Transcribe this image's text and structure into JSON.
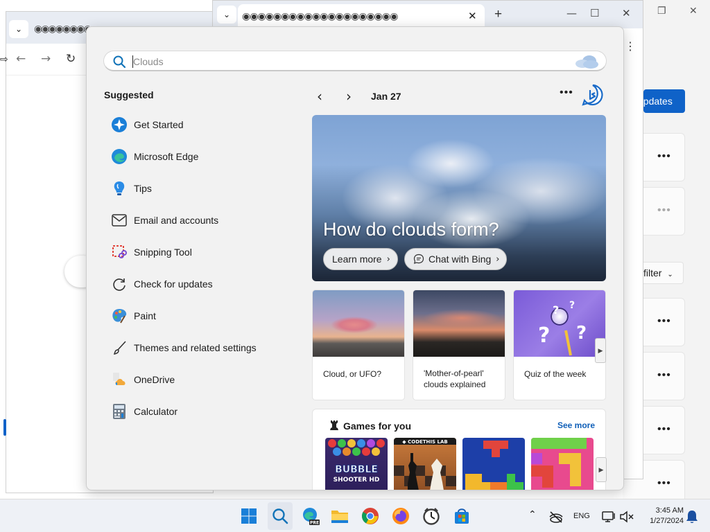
{
  "search": {
    "placeholder": "Clouds",
    "value": ""
  },
  "suggested": {
    "title": "Suggested",
    "items": [
      {
        "label": "Get Started",
        "icon": "get-started-icon"
      },
      {
        "label": "Microsoft Edge",
        "icon": "edge-icon"
      },
      {
        "label": "Tips",
        "icon": "tips-icon"
      },
      {
        "label": "Email and accounts",
        "icon": "mail-icon"
      },
      {
        "label": "Snipping Tool",
        "icon": "snipping-tool-icon"
      },
      {
        "label": "Check for updates",
        "icon": "refresh-icon"
      },
      {
        "label": "Paint",
        "icon": "paint-icon"
      },
      {
        "label": "Themes and related settings",
        "icon": "brush-icon"
      },
      {
        "label": "OneDrive",
        "icon": "onedrive-icon"
      },
      {
        "label": "Calculator",
        "icon": "calculator-icon"
      }
    ]
  },
  "highlights": {
    "date": "Jan 27",
    "hero": {
      "title": "How do clouds form?",
      "learn_more": "Learn more",
      "chat_bing": "Chat with Bing"
    },
    "cards": [
      {
        "caption": "Cloud, or UFO?"
      },
      {
        "caption": "'Mother-of-pearl' clouds explained"
      },
      {
        "caption": "Quiz of the week"
      }
    ],
    "games": {
      "title": "Games for you",
      "see_more": "See more",
      "tile1_text": "BUBBLE SHOOTER HD",
      "tile2_text": "CODETHISLAB"
    }
  },
  "background": {
    "updates_button": "updates",
    "filter_label": "filter",
    "taskbar_partial_text": "Windows"
  },
  "taskbar": {
    "language": "ENG",
    "time": "3:45 AM",
    "date": "1/27/2024",
    "pre_badge": "PRE"
  },
  "colors": {
    "accent": "#0f62c8",
    "link": "#0f5fb8",
    "panel_bg": "#f2f2f2"
  }
}
